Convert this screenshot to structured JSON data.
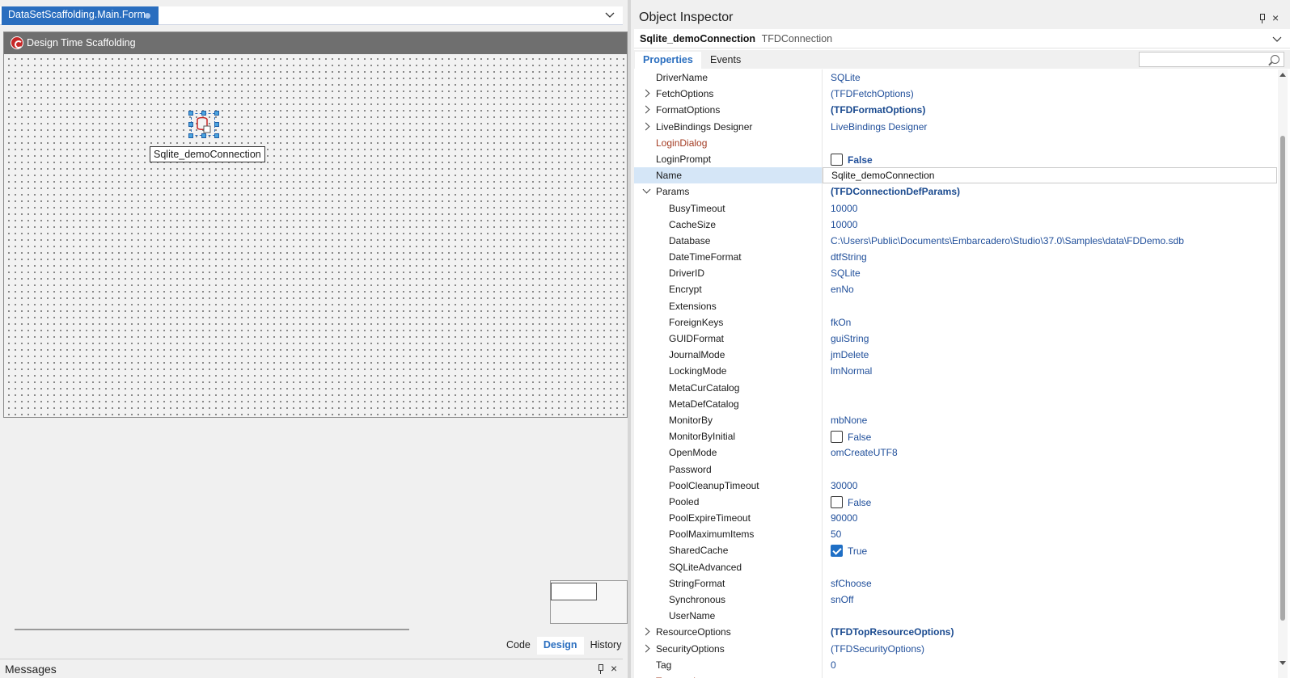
{
  "designer": {
    "tab_label": "DataSetScaffolding.Main.Form",
    "form_caption": "Design Time Scaffolding",
    "component_label": "Sqlite_demoConnection",
    "view_tabs": [
      {
        "label": "Code",
        "active": false
      },
      {
        "label": "Design",
        "active": true
      },
      {
        "label": "History",
        "active": false
      }
    ],
    "messages_title": "Messages"
  },
  "inspector": {
    "title": "Object Inspector",
    "selected_component": "Sqlite_demoConnection",
    "selected_type": "TFDConnection",
    "tabs": [
      "Properties",
      "Events"
    ],
    "properties": [
      {
        "name": "DriverName",
        "value": "SQLite"
      },
      {
        "name": "FetchOptions",
        "value": "(TFDFetchOptions)",
        "expander": "right"
      },
      {
        "name": "FormatOptions",
        "value": "(TFDFormatOptions)",
        "expander": "right",
        "bold": true
      },
      {
        "name": "LiveBindings Designer",
        "value": "LiveBindings Designer",
        "expander": "right"
      },
      {
        "name": "LoginDialog",
        "value": "",
        "red": true
      },
      {
        "name": "LoginPrompt",
        "value": "False",
        "checkbox": true,
        "checked": false,
        "bold": true
      },
      {
        "name": "Name",
        "value": "Sqlite_demoConnection",
        "selected": true
      },
      {
        "name": "Params",
        "value": "(TFDConnectionDefParams)",
        "expander": "down",
        "bold": true
      },
      {
        "name": "BusyTimeout",
        "value": "10000",
        "child": true
      },
      {
        "name": "CacheSize",
        "value": "10000",
        "child": true
      },
      {
        "name": "Database",
        "value": "C:\\Users\\Public\\Documents\\Embarcadero\\Studio\\37.0\\Samples\\data\\FDDemo.sdb",
        "child": true
      },
      {
        "name": "DateTimeFormat",
        "value": "dtfString",
        "child": true
      },
      {
        "name": "DriverID",
        "value": "SQLite",
        "child": true
      },
      {
        "name": "Encrypt",
        "value": "enNo",
        "child": true
      },
      {
        "name": "Extensions",
        "value": "",
        "child": true
      },
      {
        "name": "ForeignKeys",
        "value": "fkOn",
        "child": true
      },
      {
        "name": "GUIDFormat",
        "value": "guiString",
        "child": true
      },
      {
        "name": "JournalMode",
        "value": "jmDelete",
        "child": true
      },
      {
        "name": "LockingMode",
        "value": "lmNormal",
        "child": true
      },
      {
        "name": "MetaCurCatalog",
        "value": "",
        "child": true
      },
      {
        "name": "MetaDefCatalog",
        "value": "",
        "child": true
      },
      {
        "name": "MonitorBy",
        "value": "mbNone",
        "child": true
      },
      {
        "name": "MonitorByInitial",
        "value": "False",
        "child": true,
        "checkbox": true,
        "checked": false
      },
      {
        "name": "OpenMode",
        "value": "omCreateUTF8",
        "child": true
      },
      {
        "name": "Password",
        "value": "",
        "child": true
      },
      {
        "name": "PoolCleanupTimeout",
        "value": "30000",
        "child": true
      },
      {
        "name": "Pooled",
        "value": "False",
        "child": true,
        "checkbox": true,
        "checked": false
      },
      {
        "name": "PoolExpireTimeout",
        "value": "90000",
        "child": true
      },
      {
        "name": "PoolMaximumItems",
        "value": "50",
        "child": true
      },
      {
        "name": "SharedCache",
        "value": "True",
        "child": true,
        "checkbox": true,
        "checked": true
      },
      {
        "name": "SQLiteAdvanced",
        "value": "",
        "child": true
      },
      {
        "name": "StringFormat",
        "value": "sfChoose",
        "child": true
      },
      {
        "name": "Synchronous",
        "value": "snOff",
        "child": true
      },
      {
        "name": "UserName",
        "value": "",
        "child": true
      },
      {
        "name": "ResourceOptions",
        "value": "(TFDTopResourceOptions)",
        "expander": "right",
        "bold": true
      },
      {
        "name": "SecurityOptions",
        "value": "(TFDSecurityOptions)",
        "expander": "right"
      },
      {
        "name": "Tag",
        "value": "0"
      },
      {
        "name": "Transaction",
        "value": "",
        "red": true
      }
    ]
  }
}
